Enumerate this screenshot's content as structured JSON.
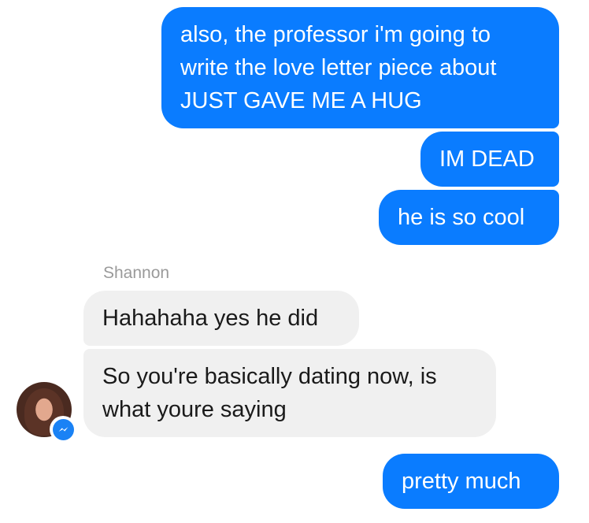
{
  "messages": {
    "m1_lines": [
      "also, the professor i'm going to",
      "write the love letter piece about",
      "JUST GAVE ME A HUG"
    ],
    "m2": "IM DEAD",
    "m3": "he is so cool",
    "sender_name": "Shannon",
    "m4": "Hahahaha yes he did",
    "m5_lines": [
      "So you're basically dating now, is",
      "what youre saying"
    ],
    "m6": "pretty much"
  },
  "contact": {
    "avatar_icon": "profile-photo-avatar",
    "badge_icon": "messenger-badge-icon"
  },
  "colors": {
    "outgoing_bubble": "#0a7cff",
    "incoming_bubble": "#f0f0f0",
    "sender_label": "#9a9a9a",
    "badge": "#1a82f5"
  }
}
